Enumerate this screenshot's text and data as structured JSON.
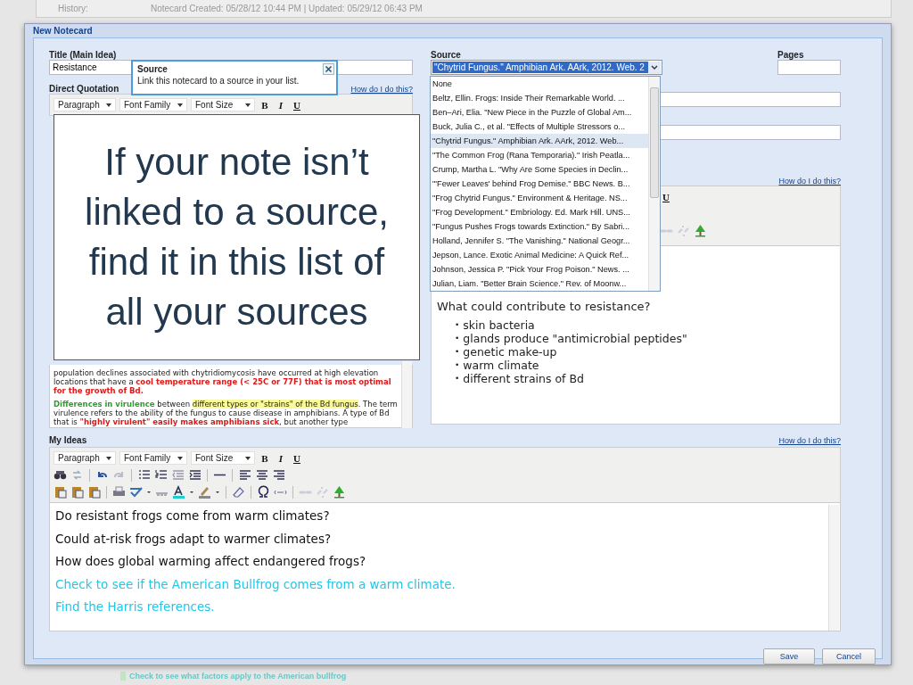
{
  "page_header": {
    "label": "History:",
    "value": "Notecard Created: 05/28/12 10:44 PM | Updated: 05/29/12 06:43 PM"
  },
  "dialog": {
    "title": "New Notecard"
  },
  "title_field": {
    "label": "Title (Main Idea)",
    "value": "Resistance"
  },
  "quotation": {
    "label": "Direct Quotation",
    "help_link": "How do I do this?",
    "selects": [
      "Paragraph",
      "Font Family",
      "Font Size"
    ],
    "style_buttons": [
      "B",
      "I",
      "U"
    ],
    "paragraphs": [
      {
        "segments": [
          {
            "text": "population declines associated with chytridiomycosis have occurred at high elevation locations that have a ",
            "kind": "plain"
          },
          {
            "text": "cool temperature range (< 25C or 77F) that is most optimal for the growth of Bd.",
            "kind": "red"
          }
        ]
      },
      {
        "segments": [
          {
            "text": "Differences in virulence",
            "kind": "green"
          },
          {
            "text": " between ",
            "kind": "plain"
          },
          {
            "text": "different types or \"strains\" of the Bd fungus",
            "kind": "highlight"
          },
          {
            "text": ". The term virulence refers to the ability of the fungus to cause disease in amphibians. A type of Bd that is ",
            "kind": "plain"
          },
          {
            "text": "\"highly virulent\" easily makes amphibians sick",
            "kind": "red"
          },
          {
            "text": ", but another type",
            "kind": "plain"
          }
        ]
      }
    ]
  },
  "source": {
    "label": "Source",
    "value": "\"Chytrid Fungus.\" Amphibian Ark. AArk, 2012. Web. 2",
    "options": [
      {
        "text": "None",
        "selected": false
      },
      {
        "text": "Beltz, Ellin. Frogs: Inside Their Remarkable World. ...",
        "selected": false
      },
      {
        "text": "Ben–Ari, Elia. \"New Piece in the Puzzle of Global Am...",
        "selected": false
      },
      {
        "text": "Buck, Julia C., et al. \"Effects of Multiple Stressors o...",
        "selected": false
      },
      {
        "text": "\"Chytrid Fungus.\" Amphibian Ark. AArk, 2012. Web...",
        "selected": true
      },
      {
        "text": "\"The Common Frog (Rana Temporaria).\" Irish Peatla...",
        "selected": false
      },
      {
        "text": "Crump, Martha L. \"Why Are Some Species in Declin...",
        "selected": false
      },
      {
        "text": "\"'Fewer Leaves' behind Frog Demise.\" BBC News. B...",
        "selected": false
      },
      {
        "text": "\"Frog Chytrid Fungus.\" Environment & Heritage. NS...",
        "selected": false
      },
      {
        "text": "\"Frog Development.\" Embriology. Ed. Mark Hill. UNS...",
        "selected": false
      },
      {
        "text": "\"Fungus Pushes Frogs towards Extinction.\" By Sabri...",
        "selected": false
      },
      {
        "text": "Holland, Jennifer S. \"The Vanishing.\" National Geogr...",
        "selected": false
      },
      {
        "text": "Jepson, Lance. Exotic Animal Medicine: A Quick Ref...",
        "selected": false
      },
      {
        "text": "Johnson, Jessica P. \"Pick Your Frog Poison.\" News. ...",
        "selected": false
      },
      {
        "text": "Julian, Liam. \"Better Brain Science.\" Rev. of Moonw...",
        "selected": false
      }
    ]
  },
  "pages": {
    "label": "Pages"
  },
  "notes_editor": {
    "help_link": "How do I do this?",
    "bullet_marker": "•",
    "style_buttons": [
      "U"
    ],
    "question": "What could contribute to resistance?",
    "bullets": [
      "skin bacteria",
      "glands produce \"antimicrobial peptides\"",
      "genetic make-up",
      "warm climate",
      "different strains of Bd"
    ]
  },
  "my_ideas": {
    "label": "My Ideas",
    "help_link": "How do I do this?",
    "selects": [
      "Paragraph",
      "Font Family",
      "Font Size"
    ],
    "style_buttons": [
      "B",
      "I",
      "U"
    ],
    "lines": [
      {
        "text": "Do resistant frogs come from warm climates?",
        "kind": "plain"
      },
      {
        "text": "Could at-risk frogs adapt to warmer climates?",
        "kind": "plain"
      },
      {
        "text": "How does global warming affect endangered frogs?",
        "kind": "plain"
      },
      {
        "text": "Check to see if the American Bullfrog comes from a warm climate.",
        "kind": "todo"
      },
      {
        "text": "Find the Harris references.",
        "kind": "todo"
      }
    ]
  },
  "buttons": [
    {
      "label": "Save"
    },
    {
      "label": "Cancel"
    }
  ],
  "tooltip": {
    "title": "Source",
    "text": "Link this notecard to a source in your list."
  },
  "callout": {
    "text": "If your note isn’t linked to a source, find it in this list of all your sources"
  },
  "footer_note": "Check to see what factors apply to the American bullfrog"
}
